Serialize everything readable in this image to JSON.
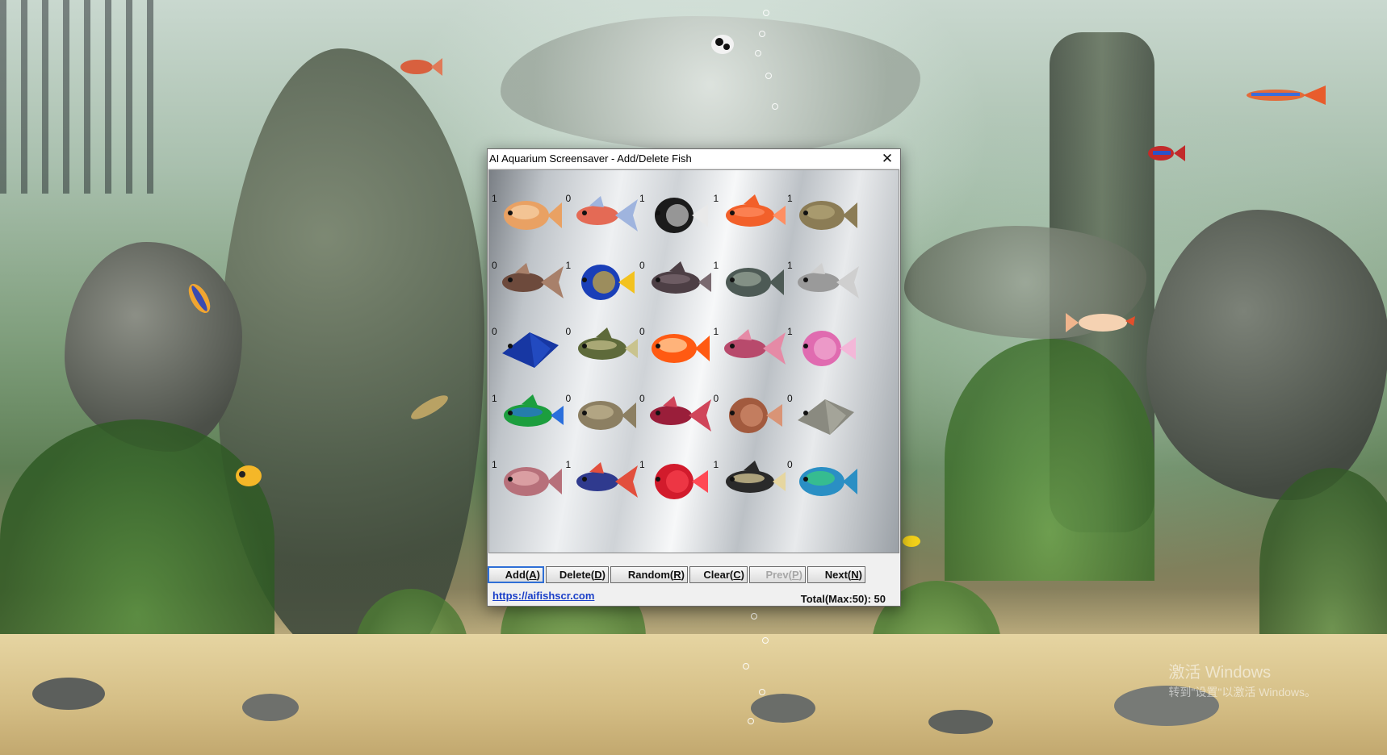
{
  "dialog": {
    "title": "AI Aquarium Screensaver - Add/Delete Fish",
    "close_glyph": "✕"
  },
  "fish_grid": [
    {
      "count": "1",
      "fish": "angelfish-orange",
      "colors": [
        "#e9a163",
        "#f6d3a9"
      ]
    },
    {
      "count": "0",
      "fish": "discus-blue-red",
      "colors": [
        "#e46a55",
        "#9fb4de"
      ]
    },
    {
      "count": "1",
      "fish": "black-moor-goldfish",
      "colors": [
        "#1b1b1b",
        "#e9e9e9"
      ]
    },
    {
      "count": "1",
      "fish": "guppy-red-tail",
      "colors": [
        "#f2602a",
        "#ff8f63"
      ]
    },
    {
      "count": "1",
      "fish": "olive-bream",
      "colors": [
        "#8b7c55",
        "#b5a779"
      ]
    },
    {
      "count": "0",
      "fish": "brown-grouper",
      "colors": [
        "#6d4a3c",
        "#a8806a"
      ]
    },
    {
      "count": "1",
      "fish": "royal-blue-tang",
      "colors": [
        "#1a3fb8",
        "#f3c21f"
      ]
    },
    {
      "count": "0",
      "fish": "dark-tuna",
      "colors": [
        "#4d3f45",
        "#7a6a70"
      ]
    },
    {
      "count": "1",
      "fish": "spotted-goby",
      "colors": [
        "#4d5a55",
        "#9aa69a"
      ]
    },
    {
      "count": "1",
      "fish": "grey-barbel",
      "colors": [
        "#9a9a9a",
        "#cfcfcf"
      ]
    },
    {
      "count": "0",
      "fish": "blue-manta-ray",
      "colors": [
        "#1737a3",
        "#2a57d4"
      ]
    },
    {
      "count": "0",
      "fish": "tiger-barb",
      "colors": [
        "#5e6a3a",
        "#c9c38e"
      ]
    },
    {
      "count": "0",
      "fish": "red-white-goldfish",
      "colors": [
        "#ff5a12",
        "#ffd8a6"
      ]
    },
    {
      "count": "1",
      "fish": "pink-gourami",
      "colors": [
        "#b84a6c",
        "#e58aa6"
      ]
    },
    {
      "count": "1",
      "fish": "pink-betta",
      "colors": [
        "#e06bb0",
        "#f3b7d8"
      ]
    },
    {
      "count": "1",
      "fish": "rainbow-guppy",
      "colors": [
        "#1c9e3e",
        "#2a6fdc"
      ]
    },
    {
      "count": "0",
      "fish": "tan-cod",
      "colors": [
        "#8c7f62",
        "#c2b592"
      ]
    },
    {
      "count": "0",
      "fish": "crimson-grouper",
      "colors": [
        "#9a1e3a",
        "#d0455a"
      ]
    },
    {
      "count": "0",
      "fish": "bronze-snapper",
      "colors": [
        "#a25a3e",
        "#d99476"
      ]
    },
    {
      "count": "0",
      "fish": "grey-stingray",
      "colors": [
        "#8a8a80",
        "#b6b5aa"
      ]
    },
    {
      "count": "1",
      "fish": "flowerhorn-cichlid",
      "colors": [
        "#b7707a",
        "#e8b2b4"
      ]
    },
    {
      "count": "1",
      "fish": "red-blue-parrotfish",
      "colors": [
        "#2f3a8e",
        "#e24f3d"
      ]
    },
    {
      "count": "1",
      "fish": "red-tetra",
      "colors": [
        "#d21b2c",
        "#ff4a55"
      ]
    },
    {
      "count": "1",
      "fish": "zebra-angelfish",
      "colors": [
        "#2a2a2a",
        "#e6d6a0"
      ]
    },
    {
      "count": "0",
      "fish": "blue-green-parrotfish",
      "colors": [
        "#2a8fc4",
        "#3ccf7a"
      ]
    }
  ],
  "buttons": [
    {
      "label": "Add",
      "key": "A",
      "state": "active"
    },
    {
      "label": "Delete",
      "key": "D",
      "state": "normal"
    },
    {
      "label": "Random",
      "key": "R",
      "state": "normal"
    },
    {
      "label": "Clear",
      "key": "C",
      "state": "normal"
    },
    {
      "label": "Prev",
      "key": "P",
      "state": "disabled"
    },
    {
      "label": "Next",
      "key": "N",
      "state": "normal"
    }
  ],
  "footer": {
    "link_text": "https://aifishscr.com",
    "total_text": "Total(Max:50): 50"
  },
  "desktop": {
    "watermark_line1": "激活 Windows",
    "watermark_line2": "转到\"设置\"以激活 Windows。"
  }
}
